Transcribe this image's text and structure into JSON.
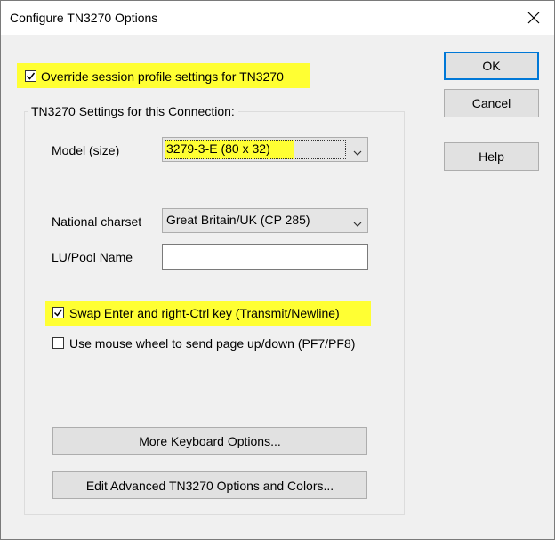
{
  "window": {
    "title": "Configure TN3270 Options"
  },
  "override": {
    "label": "Override session profile settings for TN3270",
    "checked": true
  },
  "group": {
    "title": "TN3270 Settings for this Connection:"
  },
  "model": {
    "label": "Model (size)",
    "value": "3279-3-E  (80 x 32)"
  },
  "charset": {
    "label": "National charset",
    "value": "Great Britain/UK (CP 285)"
  },
  "lupool": {
    "label": "LU/Pool Name",
    "value": ""
  },
  "swap": {
    "label": "Swap Enter and right-Ctrl key (Transmit/Newline)",
    "checked": true
  },
  "mousewheel": {
    "label": "Use mouse wheel to send page up/down (PF7/PF8)",
    "checked": false
  },
  "buttons": {
    "ok": "OK",
    "cancel": "Cancel",
    "help": "Help",
    "keyboard": "More Keyboard Options...",
    "advanced": "Edit Advanced TN3270 Options and Colors..."
  },
  "colors": {
    "highlight": "#ffff33",
    "accent": "#0078d7"
  }
}
